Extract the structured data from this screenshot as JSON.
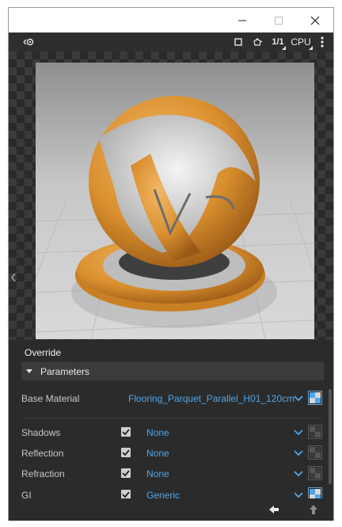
{
  "toolbar": {
    "resolution_label": "1/1",
    "engine_label": "CPU"
  },
  "panel": {
    "title": "Override",
    "section_label": "Parameters",
    "base_material": {
      "label": "Base Material",
      "value": "Flooring_Parquet_Parallel_H01_120cm"
    },
    "rows": [
      {
        "label": "Shadows",
        "checked": true,
        "value": "None"
      },
      {
        "label": "Reflection",
        "checked": true,
        "value": "None"
      },
      {
        "label": "Refraction",
        "checked": true,
        "value": "None"
      },
      {
        "label": "GI",
        "checked": true,
        "value": "Generic"
      }
    ]
  },
  "colors": {
    "accent": "#4fa6ea",
    "background": "#2b2b2b",
    "section_header": "#3b3b3b"
  },
  "icons": {
    "render_mode": "render-mode-icon",
    "region": "region-select-icon",
    "teapot": "teapot-icon",
    "more": "more-vertical-icon",
    "back": "arrow-left-icon",
    "up": "arrow-up-icon"
  }
}
